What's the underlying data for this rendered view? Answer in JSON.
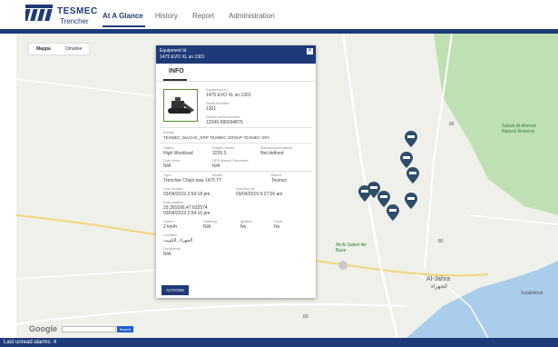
{
  "brand": {
    "name": "TESMEC",
    "product": "Trencher"
  },
  "nav": {
    "at_a_glance": "At A Glance",
    "history": "History",
    "report": "Report",
    "administration": "Administration"
  },
  "map": {
    "type_map": "Mappa",
    "type_satellite": "Omaline",
    "labels": {
      "al_jahra": "Al-Jahra",
      "al_jahra_ar": "الجهراء",
      "base": "Ali Al Salem Air Base",
      "reserve": "Sabah Al-Ahmad Natural Reserve",
      "sulaibikhat": "Sulaibikhat",
      "road1": "80",
      "road2": "80",
      "road3": "80"
    },
    "google": "Google",
    "search_label": "Search"
  },
  "popup": {
    "title_line1": "Equipment Id",
    "title_line2": "1475 EVO XL sn 1301",
    "close": "✕",
    "tab_info": "INFO",
    "fields": {
      "equipment_id_label": "Equipment Id",
      "equipment_id_value": "1475 EVO XL sn 1301",
      "serial_label": "Serial Number",
      "serial_value": "1301",
      "device_serial_label": "Device serial number",
      "device_serial_value": "12349-580094875",
      "family_label": "Family",
      "family_value": "TESMEC_MACHS_GRP TESMEC GROUP TESMEC SPA",
      "status_label": "Status",
      "status_value": "High Workload",
      "engine_hours_label": "Engine Hours",
      "engine_hours_value": "3235.3",
      "maintenance_label": "Maintenance status",
      "maintenance_value": "Not defined",
      "fuel_label": "Fuel Level",
      "fuel_value": "N/A",
      "gps_label": "GPS Based Odometer",
      "gps_value": "N/A",
      "type_label": "Type",
      "type_value": "Trencher Chain saw 1475 TT",
      "model_label": "Model",
      "model_value": "",
      "brand_label": "Brand",
      "brand_value": "Tesmec",
      "last_update_label": "Last Update",
      "last_update_value": "03/04/2019 2:54:18 pm",
      "last_keyoff_label": "Last key off",
      "last_keyoff_value": "03/04/2019 9:27:06 am",
      "last_position_label": "Last position",
      "last_position_value1": "29.391696,47.632574",
      "last_position_value2": "03/04/2019 2:54:10 pm",
      "speed_label": "Speed",
      "speed_value": "2 km/h",
      "warning_label": "Warning",
      "warning_value": "N/A",
      "ignition_label": "Ignition",
      "ignition_value": "No",
      "fault_label": "Fault",
      "fault_value": "No",
      "location_label": "Location",
      "location_value": "الجهراء ,الكويت",
      "geofence_label": "Geofences",
      "geofence_value": "N/A"
    },
    "actions": "ACTIONS"
  },
  "footer": {
    "text": "Last unread alarms: 4"
  },
  "colors": {
    "brand_blue": "#1e3a78",
    "pin": "#2e4d6b",
    "water": "#a9cdea",
    "park": "#bfe0b2"
  }
}
